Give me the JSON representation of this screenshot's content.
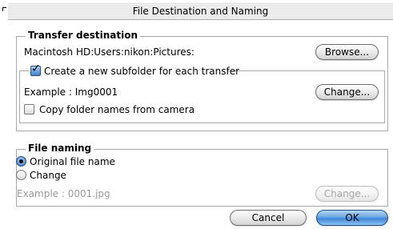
{
  "window": {
    "title": "File Destination and Naming"
  },
  "transfer_destination": {
    "legend": "Transfer  destination",
    "path": "Macintosh HD:Users:nikon:Pictures:",
    "browse_label": "Browse...",
    "subfolder": {
      "checkbox_label": "Create a new subfolder for each transfer",
      "checked": true,
      "example": "Example : Img0001",
      "change_label": "Change...",
      "copy_folder_label": "Copy folder names from camera",
      "copy_folder_checked": false
    }
  },
  "file_naming": {
    "legend": "File naming",
    "options": [
      {
        "label": "Original file name",
        "selected": true
      },
      {
        "label": "Change",
        "selected": false
      }
    ],
    "example": "Example : 0001.jpg",
    "change_label": "Change...",
    "change_enabled": false
  },
  "footer": {
    "cancel_label": "Cancel",
    "ok_label": "OK"
  },
  "colors": {
    "accent_blue": "#3f86d6",
    "group_border": "#a9a9a9",
    "disabled_text": "#9a9a9a"
  }
}
